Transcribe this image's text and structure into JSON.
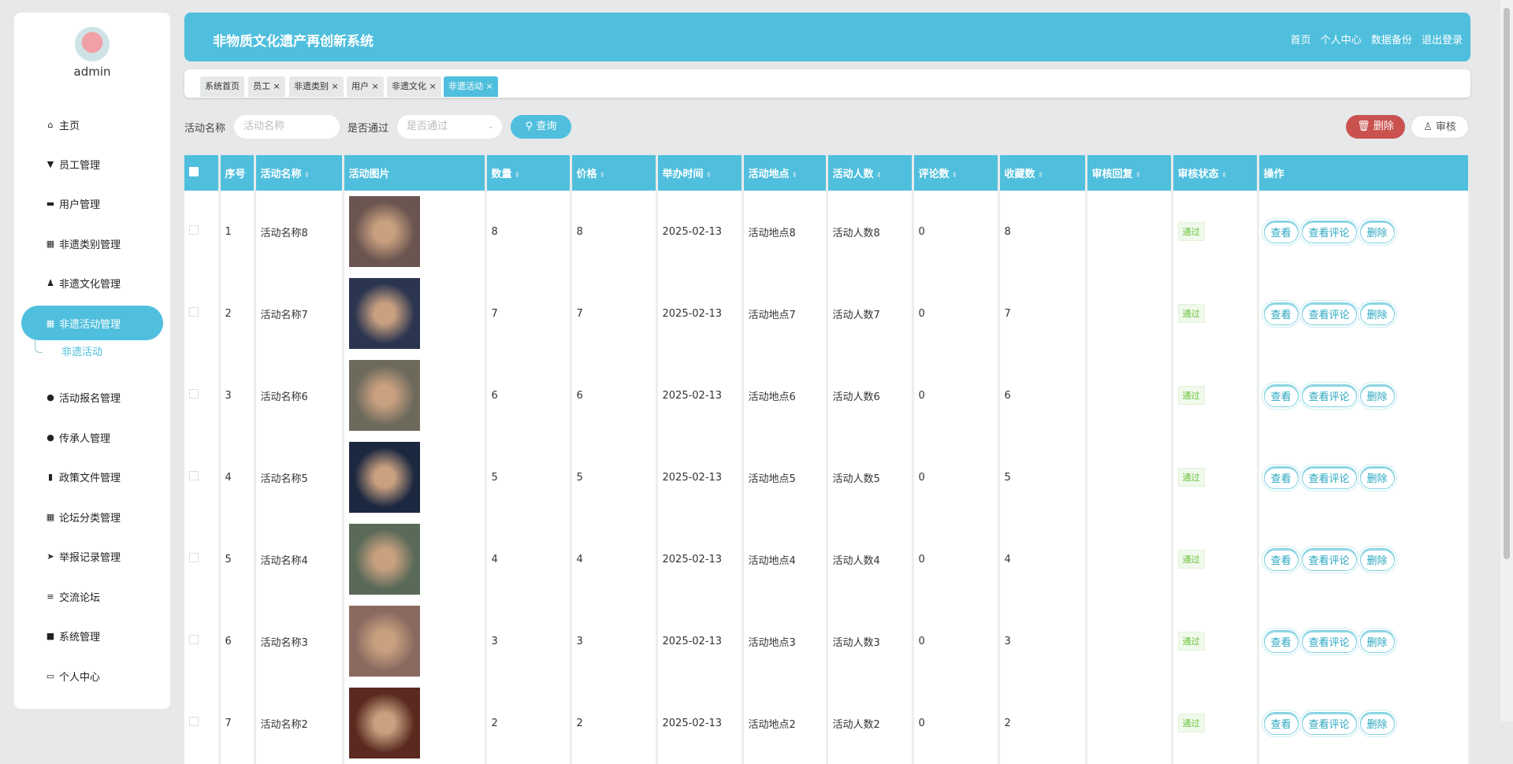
{
  "user": {
    "name": "admin"
  },
  "sidebar": {
    "items": [
      {
        "label": "主页",
        "icon": "home-icon",
        "g": "⌂"
      },
      {
        "label": "员工管理",
        "icon": "pin-icon",
        "g": "▼"
      },
      {
        "label": "用户管理",
        "icon": "comment-icon",
        "g": "▬"
      },
      {
        "label": "非遗类别管理",
        "icon": "grid-icon",
        "g": "▦"
      },
      {
        "label": "非遗文化管理",
        "icon": "user-icon",
        "g": "♟"
      },
      {
        "label": "非遗活动管理",
        "icon": "grid-icon",
        "g": "▦"
      },
      {
        "label": "活动报名管理",
        "icon": "person-icon",
        "g": "●"
      },
      {
        "label": "传承人管理",
        "icon": "bulb-icon",
        "g": "●"
      },
      {
        "label": "政策文件管理",
        "icon": "bar-chart-icon",
        "g": "▮"
      },
      {
        "label": "论坛分类管理",
        "icon": "grid-icon",
        "g": "▦"
      },
      {
        "label": "举报记录管理",
        "icon": "send-icon",
        "g": "➤"
      },
      {
        "label": "交流论坛",
        "icon": "list-icon",
        "g": "≡"
      },
      {
        "label": "系统管理",
        "icon": "wallet-icon",
        "g": "■"
      },
      {
        "label": "个人中心",
        "icon": "card-icon",
        "g": "▭"
      }
    ],
    "sub_item": "非遗活动"
  },
  "header": {
    "title": "非物质文化遗产再创新系统",
    "links": [
      "首页",
      "个人中心",
      "数据备份",
      "退出登录"
    ]
  },
  "tabs": [
    "系统首页",
    "员工 ×",
    "非遗类别 ×",
    "用户 ×",
    "非遗文化 ×",
    "非遗活动 ×"
  ],
  "search": {
    "name_label": "活动名称",
    "name_placeholder": "活动名称",
    "pass_label": "是否通过",
    "pass_placeholder": "是否通过",
    "query": "查询",
    "delete": "删除",
    "audit": "审核"
  },
  "table": {
    "headers": [
      "序号",
      "活动名称",
      "活动图片",
      "数量",
      "价格",
      "举办时间",
      "活动地点",
      "活动人数",
      "评论数",
      "收藏数",
      "审核回复",
      "审核状态",
      "操作"
    ],
    "actions": [
      "查看",
      "查看评论",
      "删除"
    ],
    "rows": [
      {
        "id": "1",
        "name": "活动名称8",
        "qty": "8",
        "price": "8",
        "date": "2025-02-13",
        "place": "活动地点8",
        "people": "活动人数8",
        "comments": "0",
        "fav": "8",
        "reply": "",
        "status": "通过",
        "color": "#6b5550"
      },
      {
        "id": "2",
        "name": "活动名称7",
        "qty": "7",
        "price": "7",
        "date": "2025-02-13",
        "place": "活动地点7",
        "people": "活动人数7",
        "comments": "0",
        "fav": "7",
        "reply": "",
        "status": "通过",
        "color": "#2b3550"
      },
      {
        "id": "3",
        "name": "活动名称6",
        "qty": "6",
        "price": "6",
        "date": "2025-02-13",
        "place": "活动地点6",
        "people": "活动人数6",
        "comments": "0",
        "fav": "6",
        "reply": "",
        "status": "通过",
        "color": "#6d6a5c"
      },
      {
        "id": "4",
        "name": "活动名称5",
        "qty": "5",
        "price": "5",
        "date": "2025-02-13",
        "place": "活动地点5",
        "people": "活动人数5",
        "comments": "0",
        "fav": "5",
        "reply": "",
        "status": "通过",
        "color": "#1c2840"
      },
      {
        "id": "5",
        "name": "活动名称4",
        "qty": "4",
        "price": "4",
        "date": "2025-02-13",
        "place": "活动地点4",
        "people": "活动人数4",
        "comments": "0",
        "fav": "4",
        "reply": "",
        "status": "通过",
        "color": "#5a6a58"
      },
      {
        "id": "6",
        "name": "活动名称3",
        "qty": "3",
        "price": "3",
        "date": "2025-02-13",
        "place": "活动地点3",
        "people": "活动人数3",
        "comments": "0",
        "fav": "3",
        "reply": "",
        "status": "通过",
        "color": "#8a6a60"
      },
      {
        "id": "7",
        "name": "活动名称2",
        "qty": "2",
        "price": "2",
        "date": "2025-02-13",
        "place": "活动地点2",
        "people": "活动人数2",
        "comments": "0",
        "fav": "2",
        "reply": "",
        "status": "通过",
        "color": "#5a2a20"
      }
    ]
  }
}
